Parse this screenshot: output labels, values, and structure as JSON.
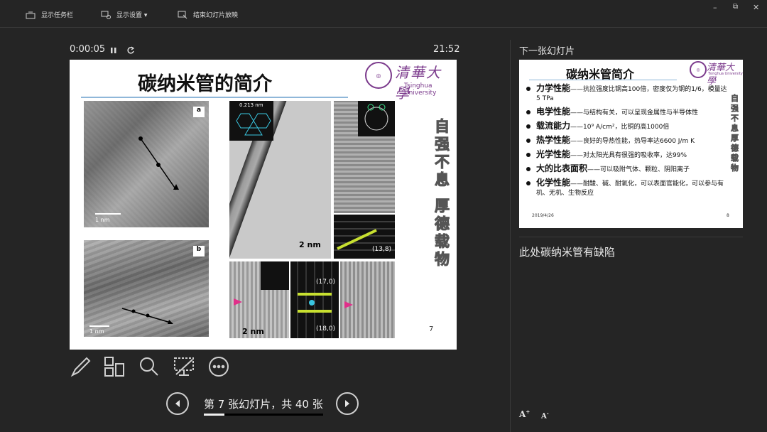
{
  "topbar": {
    "taskbar_label": "显示任务栏",
    "display_settings_label": "显示设置 ▾",
    "end_show_label": "结束幻灯片放映"
  },
  "window_controls": {
    "minimize": "–",
    "restore": "⧉",
    "close": "✕"
  },
  "presenter": {
    "timer": "0:00:05",
    "pause_icon": "pause-icon",
    "restart_icon": "restart-icon",
    "clock": "21:52",
    "slide_counter": "第 7 张幻灯片，共 40 张",
    "progress_fraction": 0.175,
    "next_slide_heading": "下一张幻灯片",
    "notes": "此处碳纳米管有缺陷",
    "font_increase": "A",
    "font_decrease": "A"
  },
  "current_slide": {
    "title": "碳纳米管的简介",
    "logo_text": "清華大學",
    "logo_subtext": "Tsinghua University",
    "motto_1": "自强不息",
    "motto_2": "厚德载物",
    "page_number": "7",
    "image_labels": {
      "a": "a",
      "b": "b",
      "scale_a": "1 nm",
      "scale_b": "1 nm",
      "lattice": "0.213 nm",
      "scale_tem": "2 nm",
      "scale_tem2": "2 nm",
      "chiral_1": "(13,8)",
      "chiral_2": "(17,0)",
      "chiral_3": "(18,0)"
    }
  },
  "next_slide": {
    "title": "碳纳米管简介",
    "logo_text": "清華大學",
    "logo_subtext": "Tsinghua University",
    "motto": "自强不息 厚德载物",
    "date": "2019/4/26",
    "page_number": "8",
    "bullets": [
      {
        "term": "力学性能",
        "text": "——抗拉强度比钢高100倍，密度仅为钢的1/6，模量达5 TPa"
      },
      {
        "term": "电学性能",
        "text": "——与结构有关，可以呈现金属性与半导体性"
      },
      {
        "term": "载流能力",
        "text": "——10⁹ A/cm²，比铜的高1000倍"
      },
      {
        "term": "热学性能",
        "text": "——良好的导热性能，热导率达6600 J/m K"
      },
      {
        "term": "光学性能",
        "text": "——对太阳光具有很强的吸收率，达99%"
      },
      {
        "term": "大的比表面积",
        "text": "——可以吸附气体、颗粒、阴阳离子"
      },
      {
        "term": "化学性能",
        "text": "——耐酸、碱、耐氧化，可以表面官能化，可以参与有机、无机、生物反应"
      }
    ]
  },
  "tools": [
    "pen-icon",
    "slides-grid-icon",
    "zoom-icon",
    "screen-off-icon",
    "more-options-icon"
  ],
  "nav": {
    "prev_icon": "previous-slide-icon",
    "next_icon": "next-slide-icon"
  }
}
